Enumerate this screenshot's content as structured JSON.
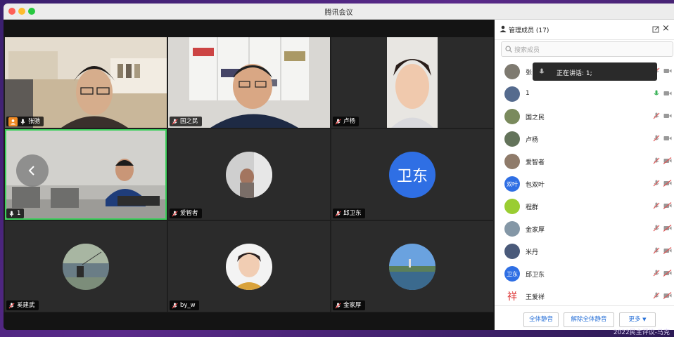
{
  "window": {
    "title": "腾讯会议"
  },
  "tiles": [
    {
      "name": "张驰",
      "host": true
    },
    {
      "name": "国之民"
    },
    {
      "name": "卢杨"
    },
    {
      "name": "1",
      "active": true
    },
    {
      "name": "爱智者"
    },
    {
      "name": "邱卫东",
      "avatar_text": "卫东"
    },
    {
      "name": "奚建武"
    },
    {
      "name": "by_w"
    },
    {
      "name": "金家厚"
    }
  ],
  "panel": {
    "title": "管理成员 (17)",
    "close": "×",
    "search_placeholder": "搜索成员",
    "speaking": "正在讲话: 1;",
    "members": [
      {
        "name": "张"
      },
      {
        "name": "1"
      },
      {
        "name": "国之民"
      },
      {
        "name": "卢杨"
      },
      {
        "name": "爱智者"
      },
      {
        "name": "包双叶",
        "avatar_text": "双叶"
      },
      {
        "name": "程群"
      },
      {
        "name": "金家厚"
      },
      {
        "name": "米丹"
      },
      {
        "name": "邱卫东",
        "avatar_text": "卫东"
      },
      {
        "name": "王爱祥",
        "avatar_text": "祥"
      }
    ],
    "buttons": {
      "mute_all": "全体静音",
      "unmute_all": "解除全体静音",
      "more": "更多"
    }
  },
  "watermark": "2022民主评议-马克",
  "colors": {
    "host_badge": "#f08a24",
    "active_border": "#3ccf5b",
    "link_blue": "#2a72d8",
    "avatar_blue": "#2f6fe4"
  }
}
